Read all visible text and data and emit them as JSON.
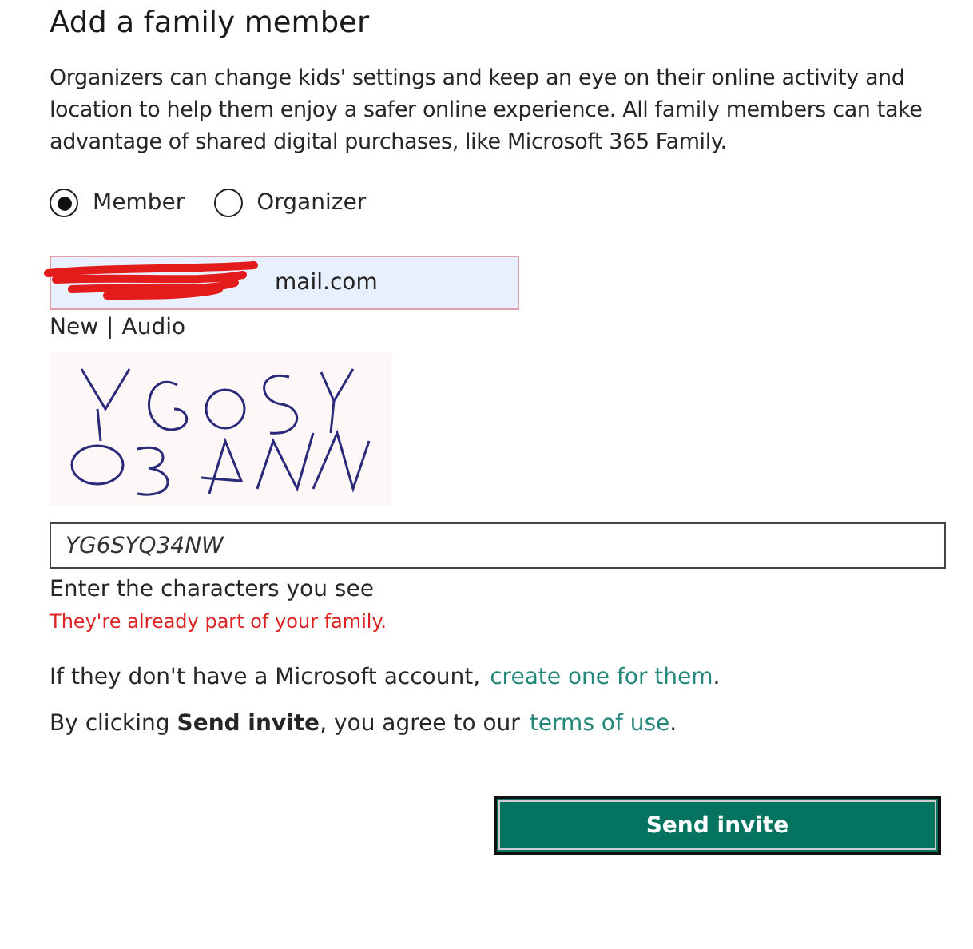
{
  "title": "Add a family member",
  "description": "Organizers can change kids' settings and keep an eye on their online activity and location to help them enjoy a safer online experience. All family members can take advantage of shared digital purchases, like Microsoft 365 Family.",
  "roles": [
    {
      "label": "Member",
      "selected": true
    },
    {
      "label": "Organizer",
      "selected": false
    }
  ],
  "email": {
    "value": "mail.com",
    "redacted": true,
    "invalid": true
  },
  "captcha_links": [
    "New",
    "Audio"
  ],
  "captcha_separator": "|",
  "captcha_input": {
    "value": "YG6SYQ34NW"
  },
  "captcha_hint": "Enter the characters you see",
  "error": "They're already part of your family.",
  "account_line": {
    "text": "If they don't have a Microsoft account,",
    "link": "create one for them",
    "end": "."
  },
  "terms_line": {
    "text": "By clicking **Send invite**, you agree to our",
    "link": "terms of use",
    "end": "."
  },
  "submit": "Send invite"
}
